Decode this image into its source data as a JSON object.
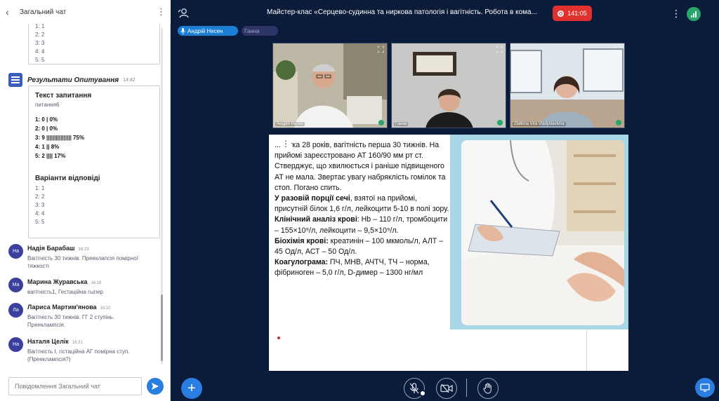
{
  "chat": {
    "title": "Загальний чат",
    "top_card_options": [
      "1: 1",
      "2: 2",
      "3: 3",
      "4: 4",
      "5: 5"
    ],
    "poll": {
      "title": "Результати Опитування",
      "time": "14:42",
      "question_heading": "Текст запитання",
      "question": "питання6",
      "results": [
        "1: 0 | 0%",
        "2: 0 | 0%",
        "3: 9 |||||||||||||||| 75%",
        "4: 1 || 8%",
        "5: 2 |||| 17%"
      ],
      "answers_heading": "Варіанти відповіді",
      "answers": [
        "1: 1",
        "2: 2",
        "3: 3",
        "4: 4",
        "5: 5"
      ]
    },
    "messages": [
      {
        "initials": "На",
        "name": "Надія Барабаш",
        "time": "16:19",
        "text": "Вагітність 30 тижнів. Прееклапсія помірної тяжкості"
      },
      {
        "initials": "Ма",
        "name": "Марина Журавська",
        "time": "16:19",
        "text": "вагітність1, Гестаційна гыпер"
      },
      {
        "initials": "Ла",
        "name": "Лариса Мартим'янова",
        "time": "16:20",
        "text": "Вагітність 30 тижнів. ГГ 2 ступінь. Прееклампсія."
      },
      {
        "initials": "На",
        "name": "Наталя Целік",
        "time": "16:21",
        "text": "Вагітність І, гістаційна АГ помірна ступ. (Прееклампсія?)"
      }
    ],
    "input_placeholder": "Повідомлення Загальний чат"
  },
  "conference": {
    "title": "Майстер-клас «Серцево-судинна та ниркова патологія і вагітність. Робота в кома...",
    "timer": "141:05",
    "speaker_tags": [
      "Андрій Несен",
      "Ганна"
    ],
    "participants": [
      {
        "label": "Андрій Несен"
      },
      {
        "label": "Ганна"
      },
      {
        "label": "Zlatkina Vira Vladyslavivna"
      }
    ]
  },
  "slide": {
    "paragraphs": [
      {
        "bold": "",
        "text": "...ентка 28 років, вагітність перша 30 тижнів. На прийомі зареєстровано АТ 160/90 мм рт ст."
      },
      {
        "bold": "",
        "text": "Стверджує, що хвилюється і раніше підвищеного АТ не мала. Звертає увагу набряклість гомілок та стоп. Погано спить."
      },
      {
        "bold": "У разовій порції сечі",
        "text": ", взятої на прийомі, присутній білок 1,6 г/л, лейкоцити 5-10 в полі зору."
      },
      {
        "bold": "Клінічний аналіз крові",
        "text": ": Hb – 110 г/л, тромбоцити – 155×10⁹/л, лейкоцити – 9,5×10⁹/л."
      },
      {
        "bold": "Біохімія крові:",
        "text": " креатинін – 100 мкмоль/л, АЛТ – 45 Од/л, АСТ – 50 Од/л."
      },
      {
        "bold": "Коагулограма:",
        "text": " ПЧ, МНВ, АЧТЧ, ТЧ – норма, фібриноген – 5,0 г/л, D-димер – 1300 нг/мл"
      }
    ]
  },
  "colors": {
    "background": "#0b1b3a",
    "accent": "#2a7de1",
    "record": "#e0312f",
    "avatar": "#3b3f9e"
  },
  "icons": {
    "back": "chevron-left-icon",
    "menu": "more-vertical-icon",
    "send": "send-icon",
    "people": "participants-icon",
    "record": "record-icon",
    "signal": "signal-icon",
    "mic_off": "mic-off-icon",
    "cam_off": "camera-off-icon",
    "hand": "raise-hand-icon",
    "add": "plus-icon",
    "screen": "screen-share-icon"
  }
}
